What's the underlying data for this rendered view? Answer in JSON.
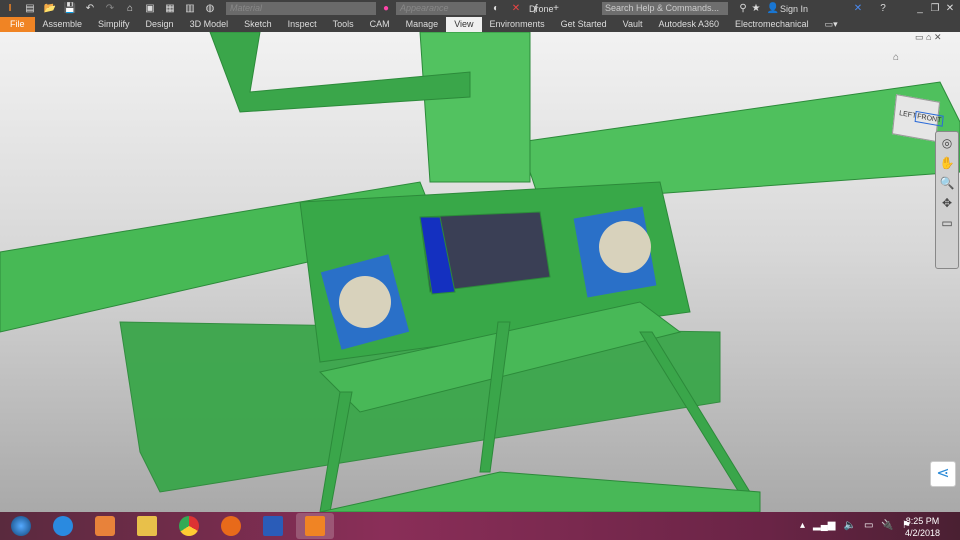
{
  "title": "Drone",
  "qat": {
    "material_placeholder": "Material",
    "appearance_placeholder": "Appearance"
  },
  "search": {
    "placeholder": "Search Help & Commands..."
  },
  "user": {
    "sign_in": "Sign In"
  },
  "ribbon": {
    "tabs": [
      "File",
      "Assemble",
      "Simplify",
      "Design",
      "3D Model",
      "Sketch",
      "Inspect",
      "Tools",
      "CAM",
      "Manage",
      "View",
      "Environments",
      "Get Started",
      "Vault",
      "Autodesk A360",
      "Electromechanical"
    ],
    "active": "View"
  },
  "viewcube": {
    "face_left": "LEFT",
    "face_front": "FRONT"
  },
  "clock": {
    "time": "8:25 PM",
    "date": "4/2/2018"
  },
  "colors": {
    "model_green": "#3fae4f",
    "file_tab": "#f08424",
    "taskbar": "#7a2a50"
  }
}
